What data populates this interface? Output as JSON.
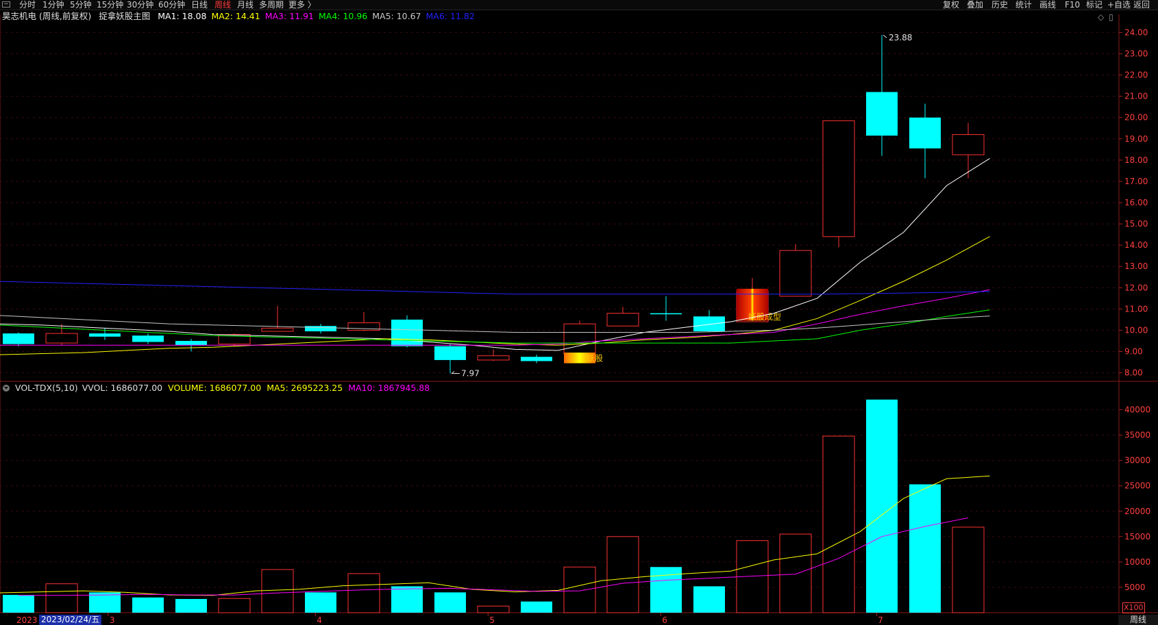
{
  "toolbar": {
    "periods": [
      "分时",
      "1分钟",
      "5分钟",
      "15分钟",
      "30分钟",
      "60分钟",
      "日线",
      "周线",
      "月线",
      "多周期",
      "更多 〉"
    ],
    "active_period": "周线",
    "right_buttons": [
      "复权",
      "叠加",
      "历史",
      "统计",
      "画线",
      "F10",
      "标记",
      "+自选",
      "返回"
    ]
  },
  "price_panel": {
    "stock_name": "昊志机电 (周线,前复权)",
    "indicator": "捉拿妖股主图",
    "ma_labels": [
      {
        "text": "MA1: 18.08",
        "color": "#ffffff"
      },
      {
        "text": "MA2: 14.41",
        "color": "#ffff00"
      },
      {
        "text": "MA3: 11.91",
        "color": "#ff00ff"
      },
      {
        "text": "MA4: 10.96",
        "color": "#00ff00"
      },
      {
        "text": "MA5: 10.67",
        "color": "#c8c8c8"
      },
      {
        "text": "MA6: 11.82",
        "color": "#2222ff"
      }
    ],
    "y_ticks": [
      "24.00",
      "23.00",
      "22.00",
      "21.00",
      "20.00",
      "19.00",
      "18.00",
      "17.00",
      "16.00",
      "15.00",
      "14.00",
      "13.00",
      "12.00",
      "11.00",
      "10.00",
      "9.00",
      "8.00"
    ],
    "high_label": "23.88",
    "low_label": "7.97",
    "signal_1": "妖股",
    "signal_2": "妖股成型"
  },
  "volume_panel": {
    "indicator": "VOL-TDX(5,10)",
    "labels": [
      {
        "text": "VVOL: 1686077.00",
        "color": "#e0e0e0"
      },
      {
        "text": "VOLUME: 1686077.00",
        "color": "#ffff00"
      },
      {
        "text": "MA5: 2695223.25",
        "color": "#ffff00"
      },
      {
        "text": "MA10: 1867945.88",
        "color": "#ff00ff"
      }
    ],
    "y_ticks": [
      "40000",
      "35000",
      "30000",
      "25000",
      "20000",
      "15000",
      "10000",
      "5000"
    ],
    "unit": "X100"
  },
  "x_axis": {
    "date_badge": "2023/02/24/五",
    "left_label": "2023",
    "month_labels": [
      "3",
      "4",
      "5",
      "6",
      "7"
    ],
    "period": "周线"
  },
  "chart_data": {
    "type": "candlestick",
    "candles": [
      {
        "open": 9.85,
        "close": 9.35,
        "high": 9.9,
        "low": 9.25
      },
      {
        "open": 9.4,
        "close": 9.85,
        "high": 10.3,
        "low": 9.3
      },
      {
        "open": 9.85,
        "close": 9.7,
        "high": 10.1,
        "low": 9.55
      },
      {
        "open": 9.75,
        "close": 9.45,
        "high": 9.85,
        "low": 9.35
      },
      {
        "open": 9.5,
        "close": 9.3,
        "high": 9.6,
        "low": 9.0
      },
      {
        "open": 9.35,
        "close": 9.8,
        "high": 9.85,
        "low": 9.25
      },
      {
        "open": 9.95,
        "close": 10.1,
        "high": 11.15,
        "low": 9.95
      },
      {
        "open": 10.2,
        "close": 9.95,
        "high": 10.3,
        "low": 9.85
      },
      {
        "open": 10.0,
        "close": 10.35,
        "high": 10.85,
        "low": 9.95
      },
      {
        "open": 10.5,
        "close": 9.25,
        "high": 10.7,
        "low": 9.2
      },
      {
        "open": 9.25,
        "close": 8.6,
        "high": 9.35,
        "low": 7.97
      },
      {
        "open": 8.6,
        "close": 8.8,
        "high": 9.1,
        "low": 8.55
      },
      {
        "open": 8.75,
        "close": 8.55,
        "high": 8.85,
        "low": 8.45
      },
      {
        "open": 8.9,
        "close": 10.3,
        "high": 10.45,
        "low": 8.9
      },
      {
        "open": 10.2,
        "close": 10.8,
        "high": 11.1,
        "low": 10.2
      },
      {
        "open": 10.8,
        "close": 10.75,
        "high": 11.6,
        "low": 10.45
      },
      {
        "open": 10.65,
        "close": 9.95,
        "high": 10.95,
        "low": 9.9
      },
      {
        "open": 10.4,
        "close": 11.85,
        "high": 12.45,
        "low": 10.4
      },
      {
        "open": 11.6,
        "close": 13.75,
        "high": 14.05,
        "low": 11.6
      },
      {
        "open": 14.4,
        "close": 19.85,
        "high": 19.85,
        "low": 13.9
      },
      {
        "open": 21.2,
        "close": 19.15,
        "high": 23.88,
        "low": 18.2
      },
      {
        "open": 20.0,
        "close": 18.55,
        "high": 20.65,
        "low": 17.15
      },
      {
        "open": 18.25,
        "close": 19.2,
        "high": 19.75,
        "low": 17.15
      }
    ],
    "volume": [
      3500,
      5700,
      4000,
      3000,
      2700,
      2800,
      8500,
      4000,
      7700,
      5200,
      4000,
      1300,
      2200,
      9000,
      15000,
      9000,
      5200,
      14200,
      15500,
      34800,
      42000,
      25300,
      16860
    ],
    "ma_series": [
      {
        "name": "MA1",
        "color": "#ffffff",
        "values": [
          10.3,
          10.25,
          10.15,
          10.05,
          9.95,
          9.8,
          9.75,
          9.7,
          9.65,
          9.6,
          9.45,
          9.3,
          9.1,
          9.05,
          9.5,
          9.9,
          10.15,
          10.4,
          10.8,
          11.5,
          13.2,
          14.6,
          16.8,
          18.08
        ]
      },
      {
        "name": "MA2",
        "color": "#ffff00",
        "values": [
          8.85,
          8.9,
          8.95,
          9.05,
          9.15,
          9.2,
          9.3,
          9.4,
          9.5,
          9.6,
          9.55,
          9.45,
          9.35,
          9.3,
          9.4,
          9.55,
          9.65,
          9.8,
          10.0,
          10.55,
          11.4,
          12.3,
          13.3,
          14.41
        ]
      },
      {
        "name": "MA3",
        "color": "#ff00ff",
        "values": [
          9.3,
          9.3,
          9.3,
          9.3,
          9.3,
          9.3,
          9.3,
          9.3,
          9.3,
          9.3,
          9.3,
          9.3,
          9.3,
          9.35,
          9.5,
          9.6,
          9.7,
          9.8,
          9.9,
          10.3,
          10.75,
          11.15,
          11.5,
          11.91
        ]
      },
      {
        "name": "MA4",
        "color": "#00ff00",
        "values": [
          10.25,
          10.15,
          10.05,
          9.95,
          9.85,
          9.75,
          9.7,
          9.65,
          9.6,
          9.55,
          9.5,
          9.45,
          9.4,
          9.4,
          9.4,
          9.4,
          9.4,
          9.4,
          9.5,
          9.6,
          10.0,
          10.3,
          10.65,
          10.96
        ]
      },
      {
        "name": "MA5",
        "color": "#c8c8c8",
        "values": [
          10.7,
          10.6,
          10.5,
          10.4,
          10.3,
          10.25,
          10.2,
          10.15,
          10.1,
          10.05,
          10.0,
          9.95,
          9.9,
          9.9,
          9.9,
          9.9,
          9.9,
          9.95,
          10.0,
          10.1,
          10.25,
          10.4,
          10.55,
          10.67
        ]
      },
      {
        "name": "MA6",
        "color": "#2222ff",
        "values": [
          12.3,
          12.25,
          12.2,
          12.15,
          12.1,
          12.05,
          12.0,
          11.95,
          11.9,
          11.85,
          11.8,
          11.75,
          11.7,
          11.7,
          11.7,
          11.7,
          11.7,
          11.7,
          11.7,
          11.7,
          11.72,
          11.75,
          11.78,
          11.82
        ]
      }
    ],
    "vol_ma5": [
      3900,
      4100,
      4300,
      4000,
      3500,
      3400,
      4300,
      4600,
      5300,
      5600,
      5900,
      4600,
      4100,
      4400,
      6300,
      7100,
      7700,
      8200,
      10400,
      11600,
      16000,
      22500,
      26400,
      26950
    ],
    "vol_ma10": [
      3400,
      3400,
      3500,
      3600,
      3500,
      3500,
      3900,
      4200,
      4500,
      4700,
      4800,
      4500,
      4200,
      4300,
      5800,
      6400,
      6800,
      7200,
      7600,
      10700,
      15000,
      17000,
      18680
    ],
    "price_range": [
      7.6,
      24.4
    ],
    "volume_range": [
      0,
      42500
    ]
  }
}
